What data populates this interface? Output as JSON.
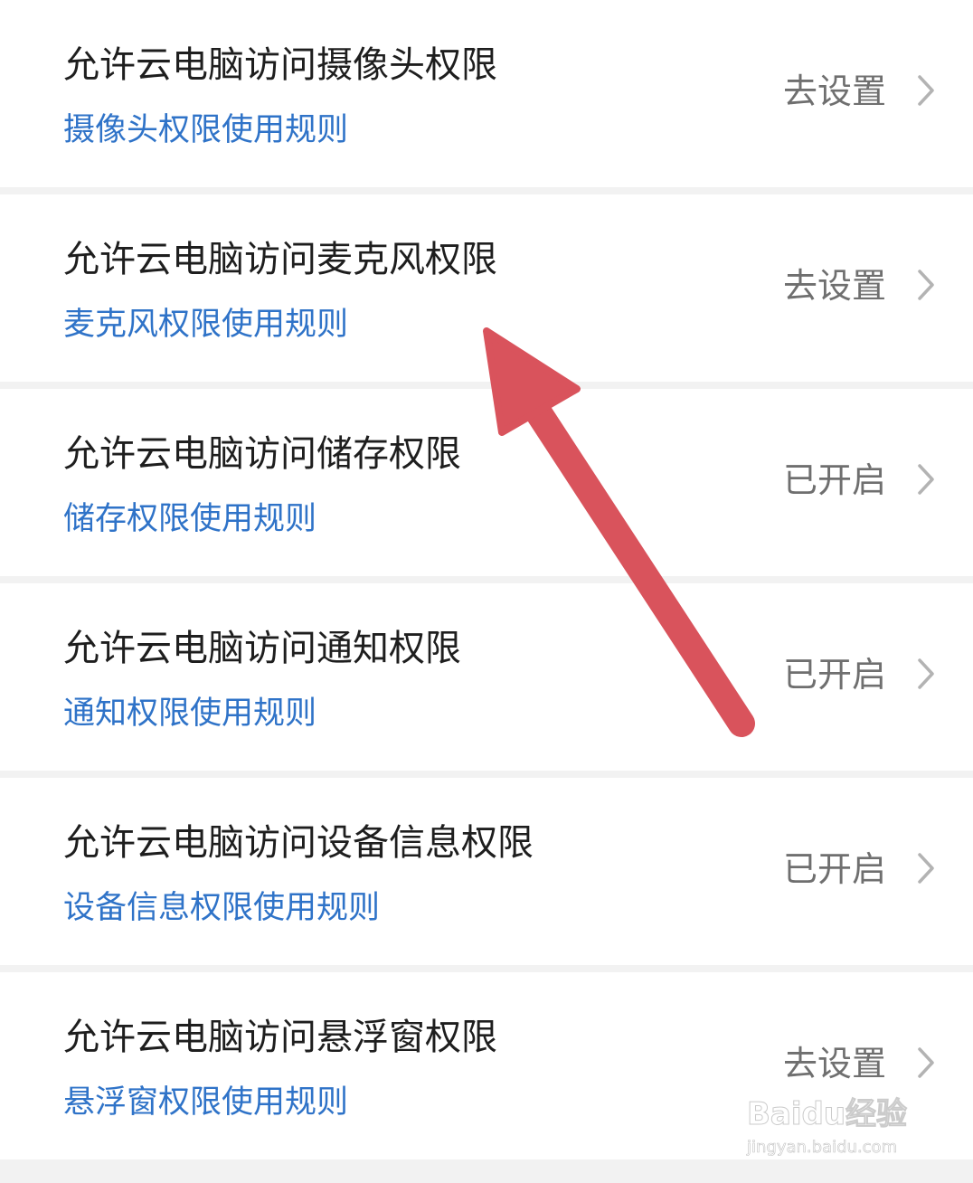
{
  "permissions": [
    {
      "title": "允许云电脑访问摄像头权限",
      "rule_link": "摄像头权限使用规则",
      "status": "去设置"
    },
    {
      "title": "允许云电脑访问麦克风权限",
      "rule_link": "麦克风权限使用规则",
      "status": "去设置"
    },
    {
      "title": "允许云电脑访问储存权限",
      "rule_link": "储存权限使用规则",
      "status": "已开启"
    },
    {
      "title": "允许云电脑访问通知权限",
      "rule_link": "通知权限使用规则",
      "status": "已开启"
    },
    {
      "title": "允许云电脑访问设备信息权限",
      "rule_link": "设备信息权限使用规则",
      "status": "已开启"
    },
    {
      "title": "允许云电脑访问悬浮窗权限",
      "rule_link": "悬浮窗权限使用规则",
      "status": "去设置"
    }
  ],
  "watermark": {
    "brand": "Baidu经验",
    "url": "jingyan.baidu.com"
  },
  "colors": {
    "background": "#f2f2f2",
    "row_background": "#ffffff",
    "title_text": "#1e1e1e",
    "link_text": "#2f73c8",
    "status_text": "#6f6f6f",
    "chevron": "#b3b3b3",
    "annotation_arrow": "#d9535c"
  },
  "icons": {
    "row_chevron": "chevron-right-icon",
    "annotation": "red-arrow-annotation"
  }
}
